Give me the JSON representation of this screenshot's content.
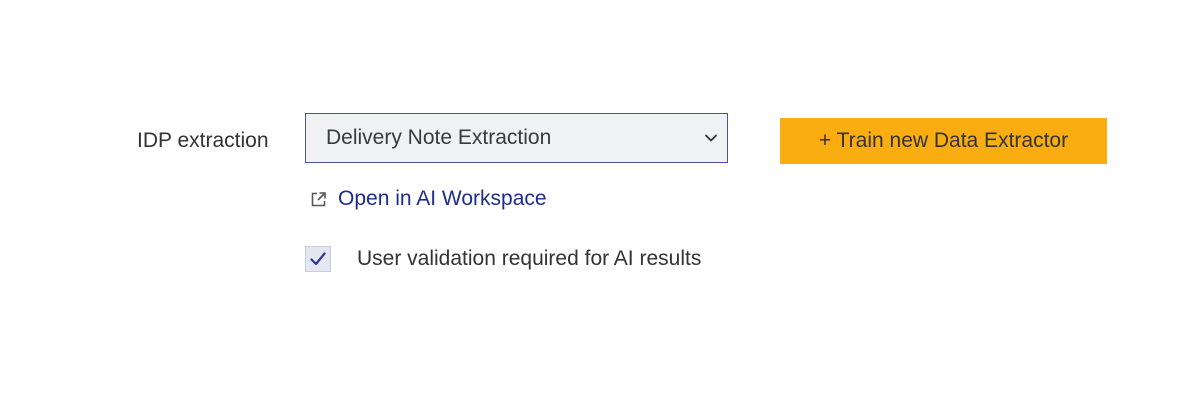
{
  "form": {
    "idp_label": "IDP extraction",
    "idp_select": {
      "selected": "Delivery Note Extraction",
      "chevron_icon": "chevron-down-icon"
    },
    "train_button": {
      "label": "+ Train new Data Extractor",
      "color": "#f9ad11"
    },
    "workspace_link": {
      "label": "Open in AI Workspace",
      "icon": "external-link-icon",
      "color": "#1d2d8c"
    },
    "validation_checkbox": {
      "checked": true,
      "label": "User validation required for AI results",
      "icon": "checkmark-icon"
    }
  }
}
